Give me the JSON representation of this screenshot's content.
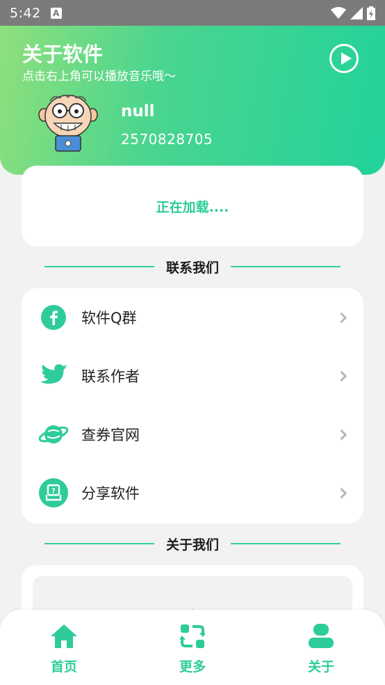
{
  "status_bar": {
    "time": "5:42",
    "notification_icon": "a-icon",
    "icons": [
      "wifi-icon",
      "signal-icon",
      "battery-icon"
    ]
  },
  "header": {
    "title": "关于软件",
    "subtitle": "点击右上角可以播放音乐哦～",
    "username": "null",
    "user_id": "2570828705",
    "play_icon": "play-icon",
    "gradient_start": "#8fe07c",
    "gradient_end": "#22d29a"
  },
  "loading": {
    "text": "正在加载...."
  },
  "sections": {
    "contact_title": "联系我们",
    "about_title": "关于我们"
  },
  "menu": {
    "items": [
      {
        "label": "软件Q群",
        "icon": "facebook-icon"
      },
      {
        "label": "联系作者",
        "icon": "twitter-icon"
      },
      {
        "label": "查券官网",
        "icon": "planet-icon"
      },
      {
        "label": "分享软件",
        "icon": "share-box-icon"
      }
    ]
  },
  "about": {
    "content": "."
  },
  "bottom_nav": {
    "items": [
      {
        "label": "首页",
        "icon": "home-icon"
      },
      {
        "label": "更多",
        "icon": "refresh-icon"
      },
      {
        "label": "关于",
        "icon": "user-icon"
      }
    ]
  },
  "colors": {
    "accent": "#2ecc9a",
    "background": "#f1f2f1"
  }
}
